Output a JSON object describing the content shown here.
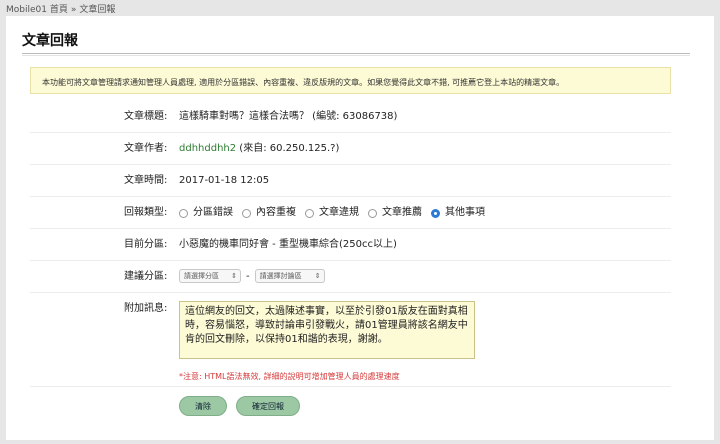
{
  "breadcrumb": {
    "home": "Mobile01 首頁",
    "separator": "»",
    "current": "文章回報"
  },
  "page": {
    "title": "文章回報"
  },
  "notice": "本功能可將文章管理請求通知管理人員處理, 適用於分區錯誤、內容重複、違反版規的文章。如果您覺得此文章不錯, 可推薦它登上本站的精選文章。",
  "form": {
    "article_title": {
      "label": "文章標題:",
      "value": "這樣騎車對嗎？這樣合法嗎？ (編號: 63086738)"
    },
    "author": {
      "label": "文章作者:",
      "name": "ddhhddhh2",
      "source": " (來自: 60.250.125.?)"
    },
    "time": {
      "label": "文章時間:",
      "value": "2017-01-18 12:05"
    },
    "report_type": {
      "label": "回報類型:",
      "options": [
        "分區錯誤",
        "內容重複",
        "文章違規",
        "文章推薦",
        "其他事項"
      ],
      "selected": "其他事項"
    },
    "current_section": {
      "label": "目前分區:",
      "value": "小惡魔的機車同好會 - 重型機車綜合(250cc以上)"
    },
    "suggest_section": {
      "label": "建議分區:",
      "select1": "請選擇分區",
      "separator": "-",
      "select2": "請選擇討論區"
    },
    "message": {
      "label": "附加訊息:",
      "value": "這位網友的回文，太過陳述事實，以至於引發01版友在面對真相時，容易惱怒，導致討論串引發戰火，請01管理員將該名網友中肯的回文刪除，以保持01和諧的表現，謝謝。",
      "hint": "*注意: HTML語法無效, 詳細的說明可增加管理人員的處理速度"
    }
  },
  "buttons": {
    "clear": "清除",
    "submit": "確定回報"
  },
  "colors": {
    "accent": "#2b7bd6",
    "button": "#9cc8a4",
    "hint": "#d63a3a",
    "notice_bg": "#fdfbd6"
  }
}
